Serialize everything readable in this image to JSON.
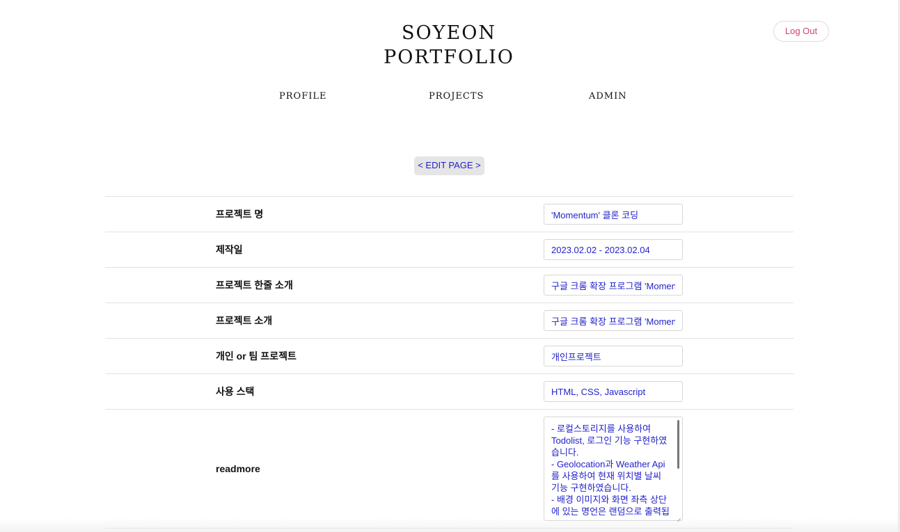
{
  "header": {
    "logo_line1": "SOYEON",
    "logo_line2": "PORTFOLIO",
    "logout_label": "Log Out"
  },
  "nav": {
    "profile": "PROFILE",
    "projects": "PROJECTS",
    "admin": "ADMIN"
  },
  "edit_page_label": "< EDIT PAGE >",
  "form": {
    "rows": [
      {
        "label": "프로젝트 명",
        "value": "'Momentum' 클론 코딩"
      },
      {
        "label": "제작일",
        "value": "2023.02.02 - 2023.02.04"
      },
      {
        "label": "프로젝트 한줄 소개",
        "value": "구글 크롬 확장 프로그램 'Momentum' 클론 코딩"
      },
      {
        "label": "프로젝트 소개",
        "value": "구글 크롬 확장 프로그램 'Momentum' 클론 코딩"
      },
      {
        "label": "개인 or 팀 프로젝트",
        "value": "개인프로젝트"
      },
      {
        "label": "사용 스택",
        "value": "HTML, CSS, Javascript"
      }
    ],
    "readmore": {
      "label": "readmore",
      "value": "- 로컬스토리지를 사용하여 Todolist, 로그인 기능 구현하였습니다.\n- Geolocation과 Weather Api를 사용하여 현재 위치별 날씨 기능 구현하였습니다.\n- 배경 이미지와 화면 좌측 상단에 있는 명언은 랜덤으로 출력됩"
    }
  }
}
